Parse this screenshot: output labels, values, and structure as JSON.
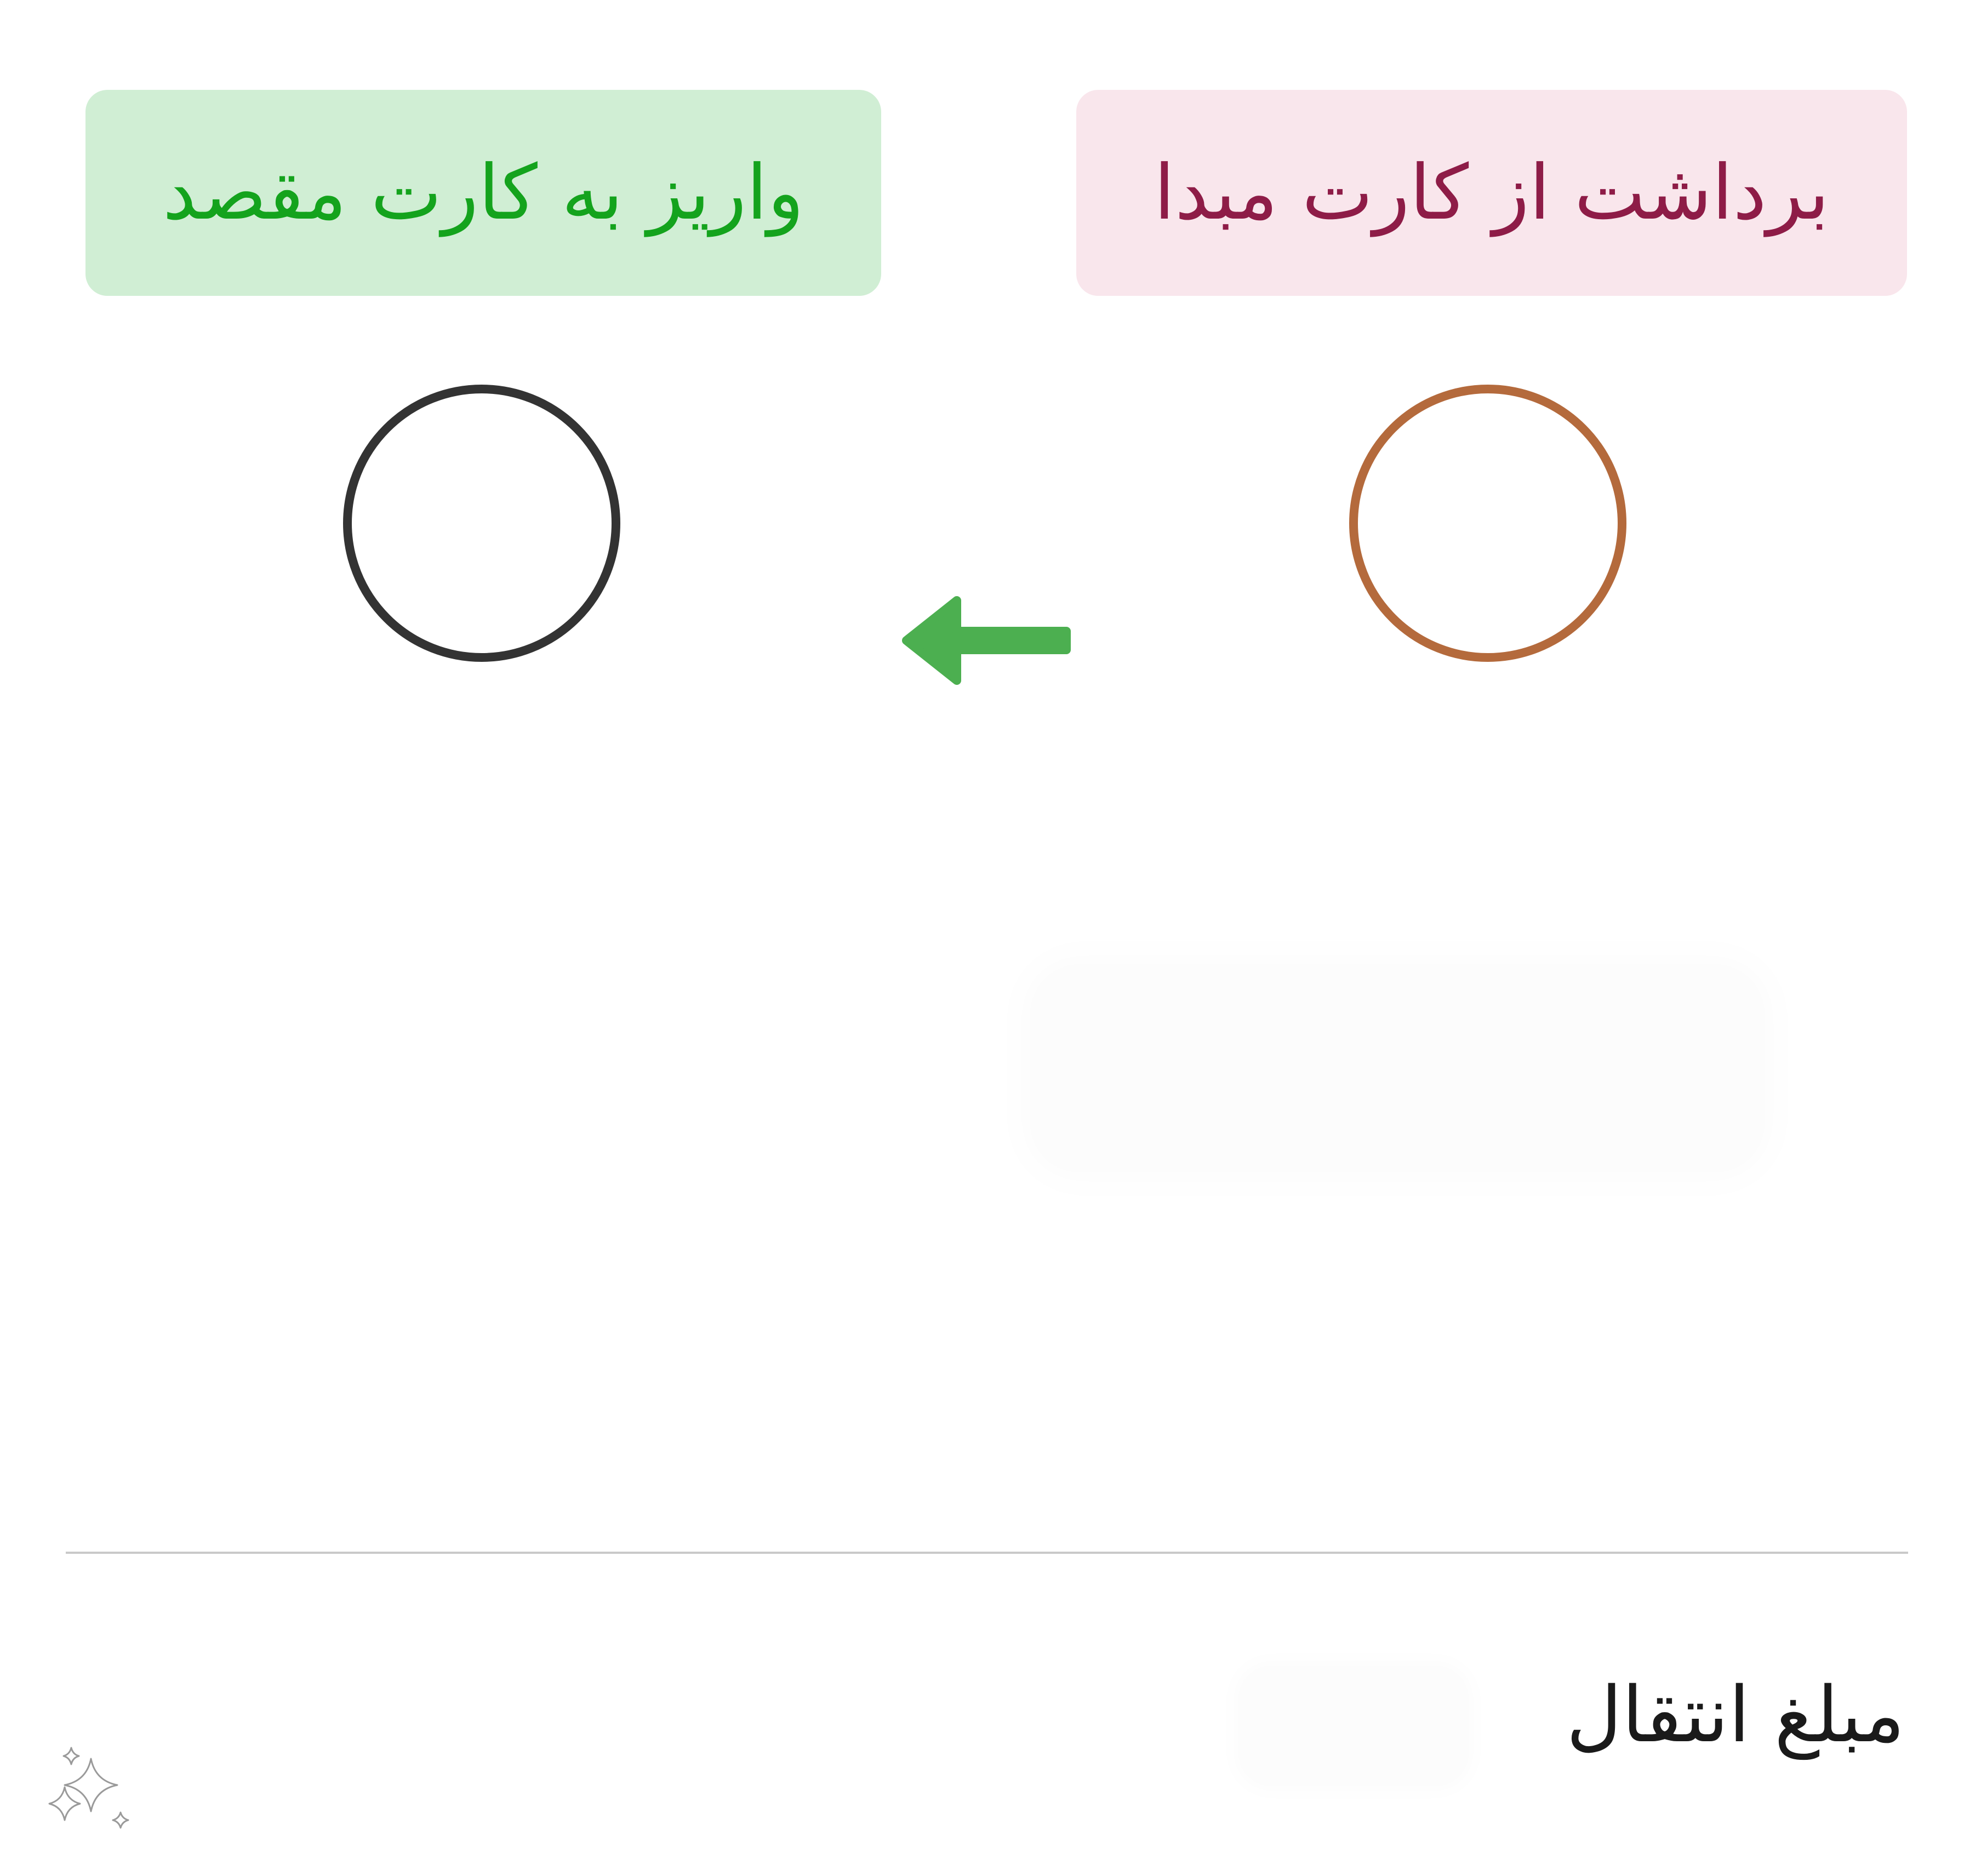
{
  "source": {
    "label": "برداشت از کارت مبدا",
    "background_color": "#f9e6ec",
    "text_color": "#8e1c47",
    "circle_color": "#b46a3c"
  },
  "destination": {
    "label": "واریز به کارت مقصد",
    "background_color": "#d0eed4",
    "text_color": "#14a31d",
    "circle_color": "#333333"
  },
  "arrow": {
    "icon": "arrow-left-icon",
    "color": "#4caf50"
  },
  "amount": {
    "label": "مبلغ انتقال"
  },
  "sparkle": {
    "icon": "sparkle-icon"
  }
}
